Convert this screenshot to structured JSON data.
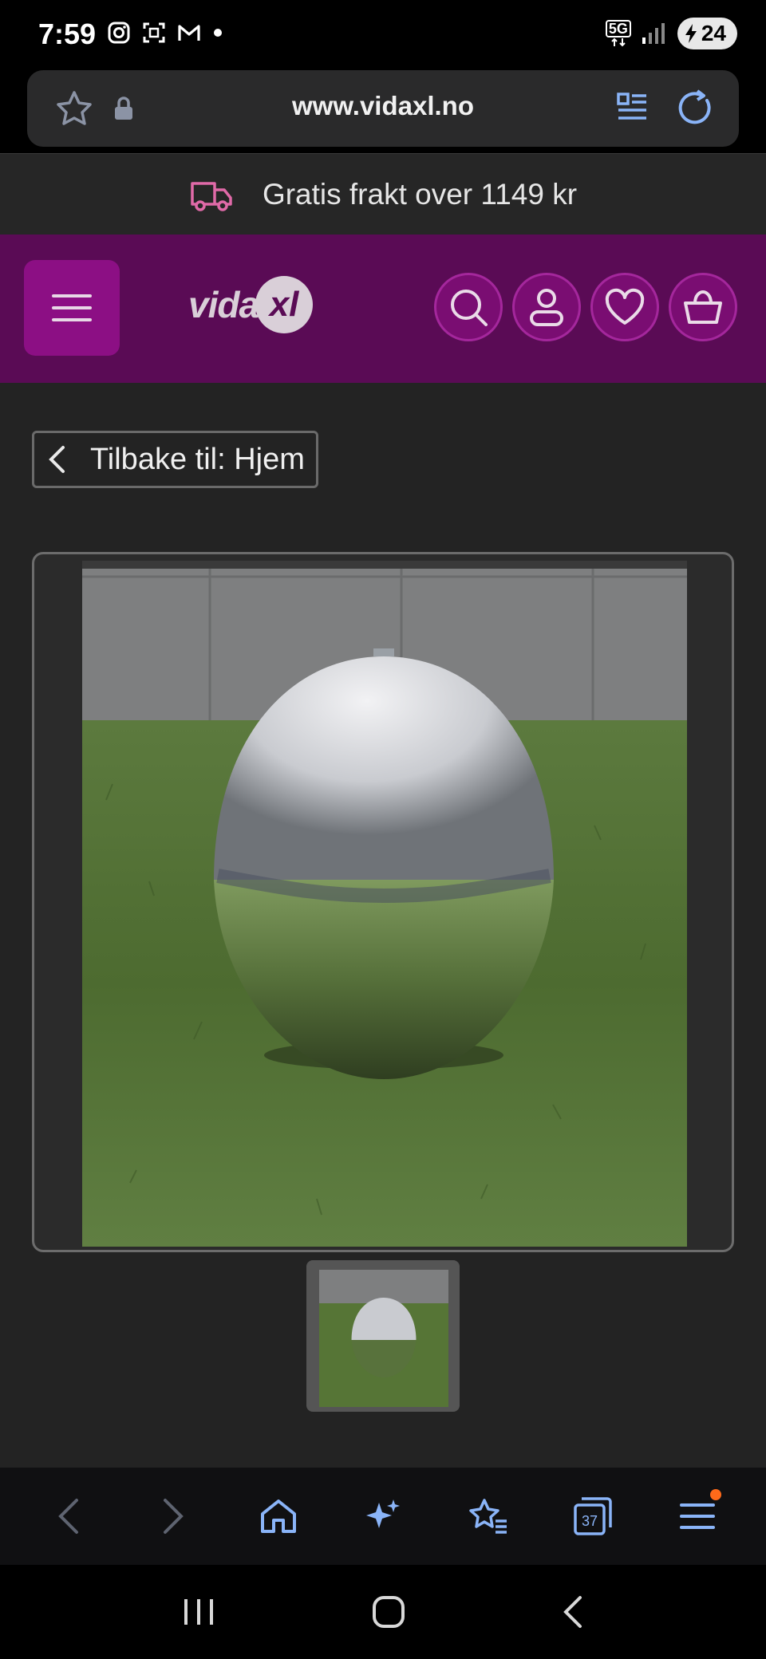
{
  "status_bar": {
    "time": "7:59",
    "battery": "24",
    "network": "5G",
    "left_icons": [
      "instagram-icon",
      "screenshot-icon",
      "gmail-icon",
      "dot-icon"
    ]
  },
  "browser": {
    "url": "www.vidaxl.no",
    "bottom_nav": [
      "back-icon",
      "forward-icon",
      "home-icon",
      "ai-sparkle-icon",
      "bookmarks-icon",
      "tabs-icon",
      "menu-icon"
    ],
    "tab_count": "37"
  },
  "site": {
    "shipping_text": "Gratis frakt over 1149 kr",
    "logo_text": "vida",
    "logo_badge": "xl",
    "header_icons": [
      "search-icon",
      "account-icon",
      "wishlist-icon",
      "cart-icon"
    ]
  },
  "product": {
    "back_label": "Tilbake til: Hjem",
    "image_desc": "stainless-steel-sphere-fountain"
  },
  "colors": {
    "brand_purple": "#5a0b55",
    "menu_button": "#8c0f84",
    "page_bg": "#232323"
  }
}
